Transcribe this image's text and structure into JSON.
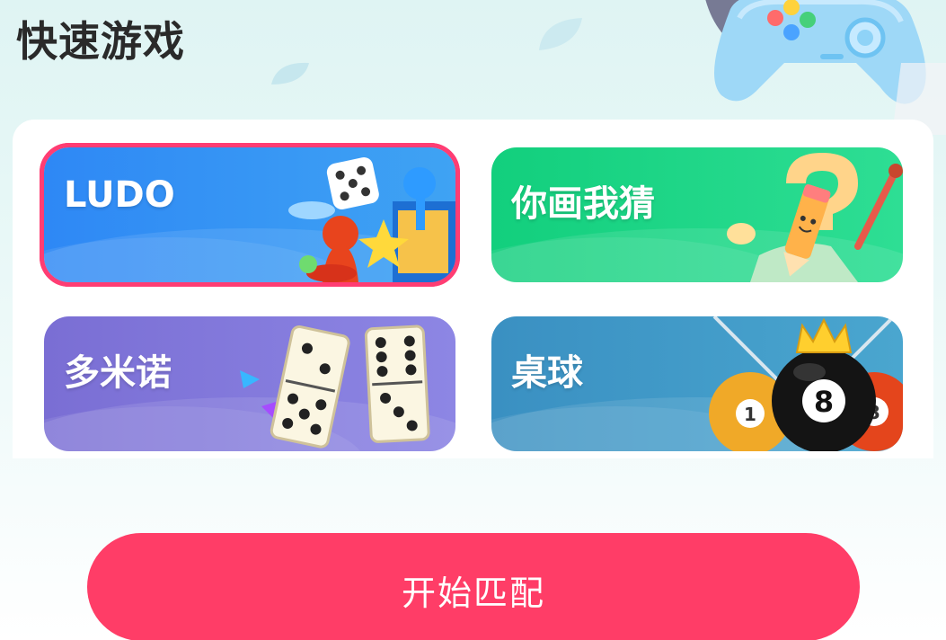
{
  "page": {
    "title": "快速游戏"
  },
  "games": [
    {
      "id": "ludo",
      "label": "LUDO",
      "selected": true,
      "icon": "ludo-dice-pawn-icon",
      "bg_from": "#2f8cf7",
      "bg_to": "#3aa6f5"
    },
    {
      "id": "draw",
      "label": "你画我猜",
      "selected": false,
      "icon": "pencil-question-icon",
      "bg_from": "#17cf7e",
      "bg_to": "#2fdc93"
    },
    {
      "id": "domino",
      "label": "多米诺",
      "selected": false,
      "icon": "domino-icon",
      "bg_from": "#7c70d6",
      "bg_to": "#8e84e3"
    },
    {
      "id": "billiards",
      "label": "桌球",
      "selected": false,
      "icon": "billiard-balls-icon",
      "bg_from": "#3b93c4",
      "bg_to": "#4aa7d0"
    }
  ],
  "actions": {
    "start_label": "开始匹配"
  },
  "colors": {
    "accent": "#ff3d67",
    "selected_border": "#ff3d73"
  },
  "decor": {
    "controller_icon": "gamepad-icon",
    "ball_8": "8",
    "ball_1": "1",
    "ball_3": "3"
  }
}
